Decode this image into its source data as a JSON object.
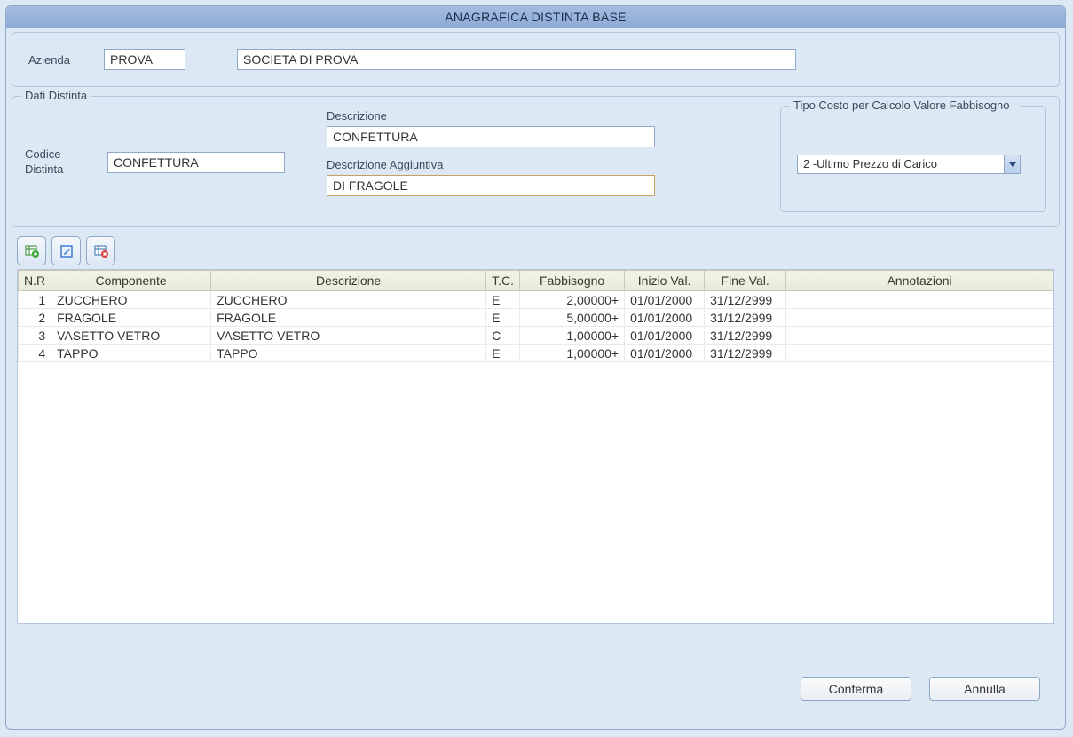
{
  "title": "ANAGRAFICA DISTINTA BASE",
  "azienda": {
    "label": "Azienda",
    "code": "PROVA",
    "name": "SOCIETA DI PROVA"
  },
  "dati_distinta": {
    "legend": "Dati Distinta",
    "codice": {
      "label": "Codice Distinta",
      "value": "CONFETTURA"
    },
    "descrizione": {
      "label": "Descrizione",
      "value": "CONFETTURA"
    },
    "descrizione_agg": {
      "label": "Descrizione Aggiuntiva",
      "value": "DI FRAGOLE"
    },
    "tipo_costo": {
      "legend": "Tipo Costo per Calcolo Valore Fabbisogno",
      "selected": "2 -Ultimo Prezzo di Carico"
    }
  },
  "grid": {
    "headers": {
      "nr": "N.R",
      "componente": "Componente",
      "descrizione": "Descrizione",
      "tc": "T.C.",
      "fabbisogno": "Fabbisogno",
      "inizio": "Inizio Val.",
      "fine": "Fine Val.",
      "annotazioni": "Annotazioni"
    },
    "rows": [
      {
        "nr": "1",
        "componente": "ZUCCHERO",
        "descrizione": "ZUCCHERO",
        "tc": "E",
        "fabbisogno": "2,00000+",
        "inizio": "01/01/2000",
        "fine": "31/12/2999",
        "annotazioni": ""
      },
      {
        "nr": "2",
        "componente": "FRAGOLE",
        "descrizione": "FRAGOLE",
        "tc": "E",
        "fabbisogno": "5,00000+",
        "inizio": "01/01/2000",
        "fine": "31/12/2999",
        "annotazioni": ""
      },
      {
        "nr": "3",
        "componente": "VASETTO VETRO",
        "descrizione": "VASETTO VETRO",
        "tc": "C",
        "fabbisogno": "1,00000+",
        "inizio": "01/01/2000",
        "fine": "31/12/2999",
        "annotazioni": ""
      },
      {
        "nr": "4",
        "componente": "TAPPO",
        "descrizione": "TAPPO",
        "tc": "E",
        "fabbisogno": "1,00000+",
        "inizio": "01/01/2000",
        "fine": "31/12/2999",
        "annotazioni": ""
      }
    ]
  },
  "buttons": {
    "confirm": "Conferma",
    "cancel": "Annulla"
  },
  "icons": {
    "add": "add-row-icon",
    "edit": "edit-row-icon",
    "delete": "delete-row-icon"
  }
}
